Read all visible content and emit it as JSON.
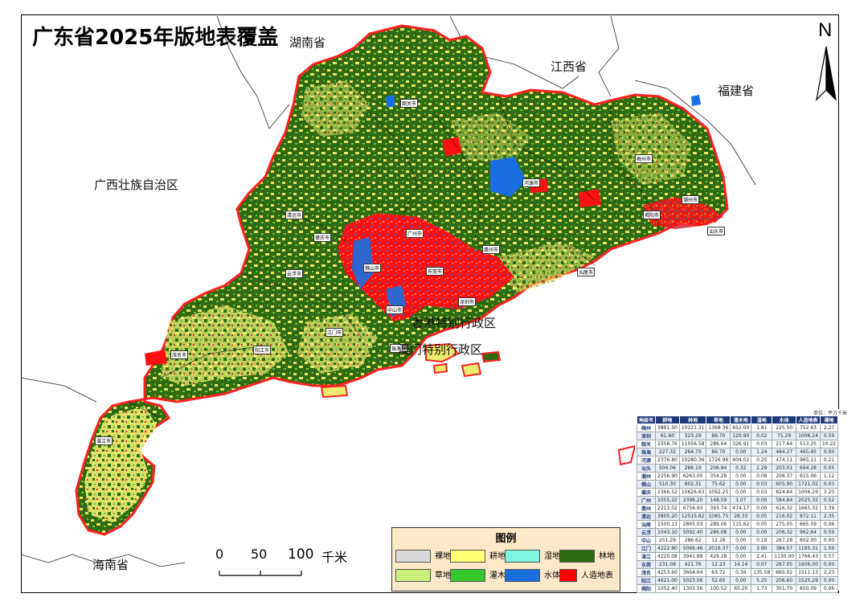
{
  "title": "广东省2025年版地表覆盖",
  "north_label": "N",
  "neighbor_labels": {
    "hunan": "湖南省",
    "jiangxi": "江西省",
    "fujian": "福建省",
    "guangxi": "广西壮族自治区",
    "hainan": "海南省",
    "hongkong": "香港特别行政区",
    "macau": "澳门特别行政区"
  },
  "scale_bar": {
    "ticks": [
      "0",
      "50",
      "100"
    ],
    "unit": "千米"
  },
  "legend": {
    "title": "图例",
    "items": [
      {
        "label": "裸地",
        "color": "#d9d9d9"
      },
      {
        "label": "耕地",
        "color": "#ffff73"
      },
      {
        "label": "湿地",
        "color": "#7ff5e0"
      },
      {
        "label": "林地",
        "color": "#2e6b12"
      },
      {
        "label": "草地",
        "color": "#c8f07a"
      },
      {
        "label": "灌木地",
        "color": "#37c82b"
      },
      {
        "label": "水体",
        "color": "#1a6fe0"
      },
      {
        "label": "人造地表",
        "color": "#ff0000"
      }
    ]
  },
  "colors": {
    "boundary": "#ff2020",
    "forest": "#2e6b12",
    "cropland": "#e8e860",
    "urban": "#ff0000",
    "water": "#1a6fe0",
    "table_header": "#1f3a7a"
  },
  "stats_table": {
    "unit": "单位：平方千米",
    "headers": [
      "地级市",
      "耕地",
      "林地",
      "草地",
      "灌木地",
      "湿地",
      "水体",
      "人造地表",
      "裸地"
    ],
    "rows": [
      [
        "梅州",
        "3891.50",
        "10221.31",
        "1368.36",
        "652.00",
        "1.81",
        "225.50",
        "752.63",
        "2.27"
      ],
      [
        "深圳",
        "61.60",
        "323.29",
        "86.70",
        "120.90",
        "0.02",
        "71.29",
        "1006.24",
        "0.59"
      ],
      [
        "韶关",
        "1558.76",
        "11056.58",
        "286.64",
        "326.91",
        "0.03",
        "217.64",
        "513.25",
        "10.22"
      ],
      [
        "珠海",
        "227.32",
        "264.79",
        "86.70",
        "0.00",
        "1.24",
        "484.27",
        "465.45",
        "0.00"
      ],
      [
        "河源",
        "2376.80",
        "10280.36",
        "1726.96",
        "404.02",
        "0.25",
        "474.11",
        "965.11",
        "0.21"
      ],
      [
        "汕头",
        "504.06",
        "286.19",
        "206.94",
        "0.32",
        "2.29",
        "203.01",
        "694.28",
        "0.05"
      ],
      [
        "潮州",
        "2256.90",
        "6263.00",
        "354.29",
        "0.00",
        "0.08",
        "206.37",
        "615.06",
        "1.12"
      ],
      [
        "佛山",
        "510.30",
        "802.31",
        "75.62",
        "0.00",
        "0.03",
        "605.90",
        "1721.02",
        "0.03"
      ],
      [
        "肇庆",
        "2366.52",
        "10626.63",
        "1092.25",
        "0.00",
        "0.03",
        "824.84",
        "1006.29",
        "3.20"
      ],
      [
        "广州",
        "1055.22",
        "2398.20",
        "148.59",
        "3.07",
        "0.00",
        "584.84",
        "2025.32",
        "0.52"
      ],
      [
        "惠州",
        "2213.02",
        "6756.93",
        "393.74",
        "474.17",
        "0.00",
        "616.32",
        "1665.32",
        "3.39"
      ],
      [
        "清远",
        "3805.20",
        "12515.82",
        "1085.75",
        "28.33",
        "0.05",
        "216.02",
        "872.11",
        "2.35"
      ],
      [
        "汕尾",
        "1500.13",
        "2865.03",
        "289.06",
        "115.62",
        "0.05",
        "275.05",
        "665.59",
        "0.06"
      ],
      [
        "云浮",
        "1043.10",
        "5092.40",
        "286.08",
        "0.00",
        "0.00",
        "206.32",
        "962.64",
        "0.59"
      ],
      [
        "中山",
        "251.29",
        "286.62",
        "12.28",
        "0.00",
        "0.19",
        "267.28",
        "602.00",
        "0.00"
      ],
      [
        "江门",
        "4222.80",
        "5066.46",
        "2016.37",
        "0.00",
        "3.90",
        "384.57",
        "1165.31",
        "1.59"
      ],
      [
        "湛江",
        "4220.08",
        "3941.88",
        "429.28",
        "0.00",
        "2.41",
        "1130.00",
        "1766.43",
        "0.57"
      ],
      [
        "东莞",
        "231.08",
        "421.76",
        "12.23",
        "14.14",
        "0.07",
        "267.05",
        "1606.00",
        "0.00"
      ],
      [
        "茂名",
        "4253.60",
        "3664.64",
        "63.72",
        "0.34",
        "135.58",
        "665.02",
        "1511.13",
        "2.23"
      ],
      [
        "阳江",
        "4621.00",
        "5023.06",
        "52.65",
        "0.00",
        "5.25",
        "206.60",
        "1525.29",
        "0.00"
      ],
      [
        "揭阳",
        "1052.40",
        "1303.56",
        "100.52",
        "65.20",
        "1.73",
        "301.70",
        "650.09",
        "0.06"
      ]
    ]
  },
  "city_labels": [
    "韶关市",
    "清远市",
    "河源市",
    "梅州市",
    "潮州市",
    "汕头市",
    "揭阳市",
    "汕尾市",
    "惠州市",
    "广州市",
    "佛山市",
    "肇庆市",
    "云浮市",
    "东莞市",
    "深圳市",
    "江门市",
    "中山市",
    "珠海市",
    "阳江市",
    "茂名市",
    "湛江市"
  ]
}
